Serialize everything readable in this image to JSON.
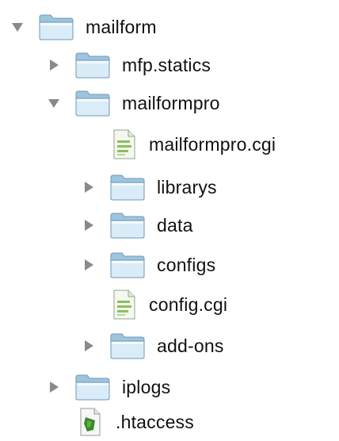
{
  "tree": {
    "items": [
      {
        "label": "mailform",
        "type": "folder",
        "expanded": true
      },
      {
        "label": "mfp.statics",
        "type": "folder",
        "expanded": false
      },
      {
        "label": "mailformpro",
        "type": "folder",
        "expanded": true
      },
      {
        "label": "mailformpro.cgi",
        "type": "file-cgi"
      },
      {
        "label": "librarys",
        "type": "folder",
        "expanded": false
      },
      {
        "label": "data",
        "type": "folder",
        "expanded": false
      },
      {
        "label": "configs",
        "type": "folder",
        "expanded": false
      },
      {
        "label": "config.cgi",
        "type": "file-cgi"
      },
      {
        "label": "add-ons",
        "type": "folder",
        "expanded": false
      },
      {
        "label": "iplogs",
        "type": "folder",
        "expanded": false
      },
      {
        "label": ".htaccess",
        "type": "file-htaccess"
      }
    ]
  },
  "icons": {
    "disclosure_open": "triangle-down-icon",
    "disclosure_closed": "triangle-right-icon",
    "folder": "folder-icon",
    "cgi_file": "cgi-file-icon",
    "htaccess_file": "htaccess-file-icon"
  },
  "colors": {
    "folder_light": "#d9ecf8",
    "folder_dark": "#9ec4de",
    "folder_edge": "#6e98b8",
    "triangle": "#8a8a8a",
    "file_green": "#8dbf62",
    "htaccess_green": "#3a8a2a"
  }
}
